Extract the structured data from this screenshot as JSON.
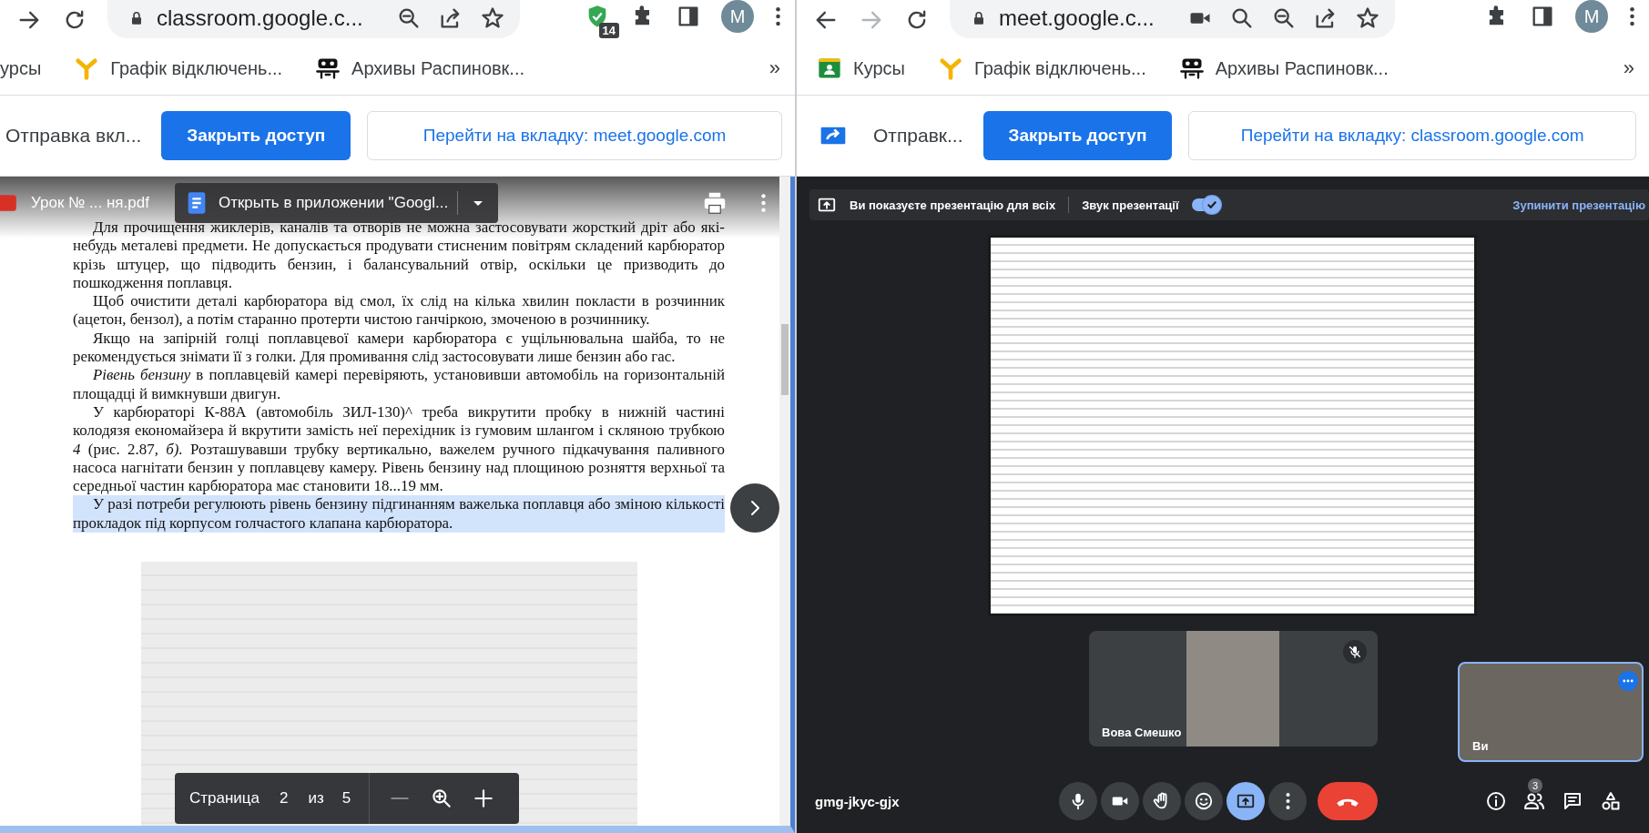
{
  "left_window": {
    "toolbar": {
      "nav": [
        {
          "kind": "forward",
          "disabled": false
        },
        {
          "kind": "reload",
          "disabled": false
        }
      ],
      "url": "classroom.google.c...",
      "omnibox_icons": [
        {
          "kind": "zoom-out"
        },
        {
          "kind": "share"
        },
        {
          "kind": "star"
        }
      ],
      "extensions": [
        {
          "kind": "shield",
          "badge": "14"
        },
        {
          "kind": "puzzle"
        },
        {
          "kind": "sidebar"
        }
      ],
      "avatar": "M"
    },
    "bookmarks": [
      {
        "kind": "none",
        "label": "урсы"
      },
      {
        "kind": "ylogo",
        "label": "Графік відключень..."
      },
      {
        "kind": "archive",
        "label": "Архивы Распиновк..."
      }
    ],
    "more_bookmarks": "»",
    "infobar": {
      "sharing_icon": false,
      "label": "Отправка вкл...",
      "stop_button": "Закрыть доступ",
      "goto_button": "Перейти на вкладку: meet.google.com"
    },
    "pdf_viewer": {
      "file_name": "Урок № ... ня.pdf",
      "open_with_button": "Открыть в приложении \"Googl...",
      "paragraphs": [
        {
          "highlighted": false,
          "text": "Для прочищення жиклерів, каналів та отворів не можна застосовувати жорсткий дріт або які-небудь металеві предмети. Не допускається продувати стисненим повітрям складений карбюратор крізь штуцер, що підводить бензин, і балансувальний отвір, оскільки це призводить до пошкодження поплавця."
        },
        {
          "highlighted": false,
          "text": "Щоб очистити деталі карбюратора від смол, їх слід на кілька хвилин покласти в розчинник (ацетон, бензол), а потім старанно протерти чистою ганчіркою, змоченою в розчиннику."
        },
        {
          "highlighted": false,
          "text": "Якщо на запірній голці поплавцевої камери карбюратора є ущільнювальна шайба, то не рекомендується знімати її з голки. Для промивання слід застосовувати лише бензин або гас."
        },
        {
          "highlighted": false,
          "text": "*Рівень бензину* в поплавцевій камері перевіряють, установивши автомобіль на горизонтальній площадці й вимкнувши двигун."
        },
        {
          "highlighted": false,
          "text": "У карбюраторі К-88А (автомобіль ЗИЛ-130)^ треба викрутити пробку в нижній частині колодязя економайзера й вкрутити замість неї перехідник із гумовим шлангом і скляною трубкою *4* (рис. 2.87, *б).* Розташувавши трубку вертикально, важелем ручного підкачування паливного насоса нагнітати бензин у поплавцеву камеру. Рівень бензину над площиною розняття верхньої та середньої частин карбюратора має становити 18...19 мм."
        },
        {
          "highlighted": true,
          "text": "У разі потреби регулюють рівень бензину підгинанням важелька поплавця або зміною кількості прокладок під корпусом голчастого клапана карбюратора."
        }
      ],
      "page_nav": {
        "label": "Страница",
        "page": "2",
        "of": "из",
        "total": "5"
      }
    }
  },
  "right_window": {
    "toolbar": {
      "nav": [
        {
          "kind": "back",
          "disabled": false
        },
        {
          "kind": "forward",
          "disabled": true
        },
        {
          "kind": "reload",
          "disabled": false
        }
      ],
      "url": "meet.google.c...",
      "omnibox_icons": [
        {
          "kind": "camera"
        },
        {
          "kind": "search"
        },
        {
          "kind": "zoom-out"
        },
        {
          "kind": "share"
        },
        {
          "kind": "star"
        }
      ],
      "extensions": [
        {
          "kind": "puzzle"
        },
        {
          "kind": "sidebar"
        }
      ],
      "avatar": "M"
    },
    "bookmarks": [
      {
        "kind": "classroom",
        "label": "Курсы"
      },
      {
        "kind": "ylogo",
        "label": "Графік відключень..."
      },
      {
        "kind": "archive",
        "label": "Архивы Распиновк..."
      }
    ],
    "more_bookmarks": "»",
    "infobar": {
      "sharing_icon": true,
      "label": "Отправк...",
      "stop_button": "Закрыть доступ",
      "goto_button": "Перейти на вкладку: classroom.google.com"
    }
  },
  "meet": {
    "presentation_bar": {
      "status": "Ви показуєте презентацію для всіх",
      "audio_label": "Звук презентації",
      "audio_on": true,
      "stop_link": "Зупинити презентацію"
    },
    "participants": [
      {
        "name": "Вова Смешко",
        "muted": true
      }
    ],
    "self_view": {
      "name": "Ви"
    },
    "meeting_code": "gmg-jkyc-gjx",
    "controls": [
      {
        "kind": "mic",
        "on": false
      },
      {
        "kind": "video",
        "on": false
      },
      {
        "kind": "hand",
        "on": false
      },
      {
        "kind": "emoji",
        "on": false
      },
      {
        "kind": "present",
        "on": true
      },
      {
        "kind": "menu",
        "on": false
      },
      {
        "kind": "hangup",
        "on": false
      }
    ],
    "side_buttons": [
      {
        "kind": "info"
      },
      {
        "kind": "people",
        "badge": "3"
      },
      {
        "kind": "chat"
      },
      {
        "kind": "activities"
      }
    ]
  }
}
